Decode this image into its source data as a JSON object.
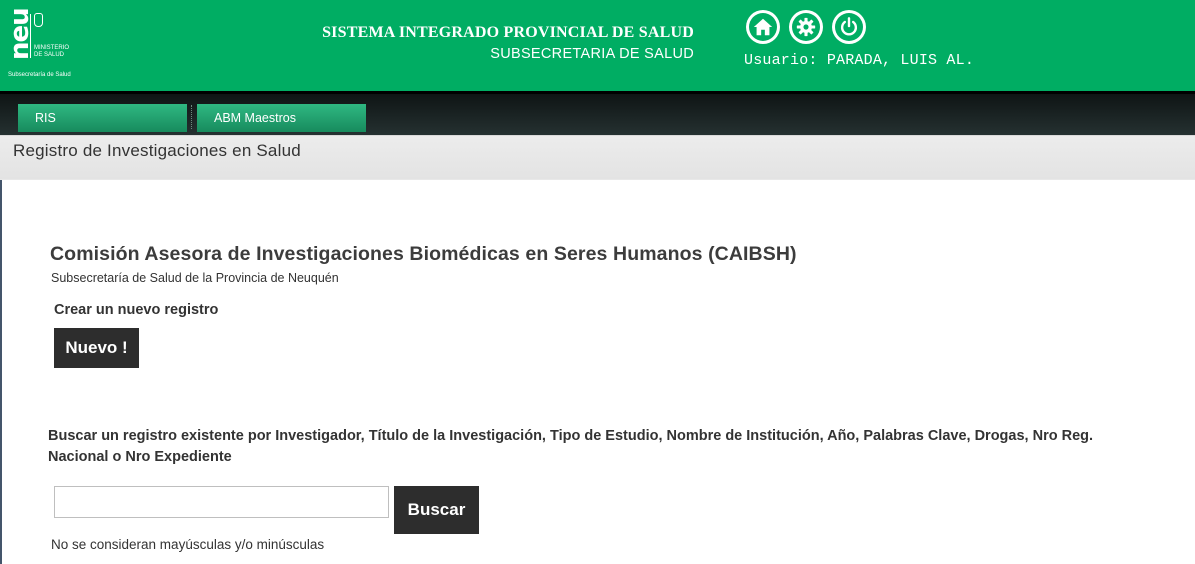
{
  "header": {
    "logo": {
      "brand": "neu",
      "ministry": [
        "MINISTERIO",
        "DE SALUD"
      ],
      "subtitle": "Subsecretaría de Salud"
    },
    "title": "SISTEMA INTEGRADO PROVINCIAL DE SALUD",
    "subtitle": "SUBSECRETARIA DE SALUD",
    "icons": [
      "home-icon",
      "gear-icon",
      "power-icon"
    ],
    "user_label": "Usuario: PARADA, LUIS AL.",
    "color": "#00ad63"
  },
  "nav": {
    "items": [
      {
        "label": "RIS"
      },
      {
        "label": "ABM Maestros"
      }
    ]
  },
  "breadcrumb": {
    "title": "Registro de Investigaciones en Salud"
  },
  "main": {
    "title": "Comisión Asesora de Investigaciones Biomédicas en Seres Humanos (CAIBSH)",
    "subtitle": "Subsecretaría de Salud de la Provincia de Neuquén",
    "create_label": "Crear un nuevo registro",
    "new_button": "Nuevo !",
    "search_label": "Buscar un registro existente por Investigador, Título de la Investigación, Tipo de Estudio, Nombre de Institución, Año, Palabras Clave, Drogas, Nro Reg. Nacional o Nro Expediente",
    "search_value": "",
    "search_button": "Buscar",
    "note": "No se consideran mayúsculas y/o minúsculas"
  }
}
